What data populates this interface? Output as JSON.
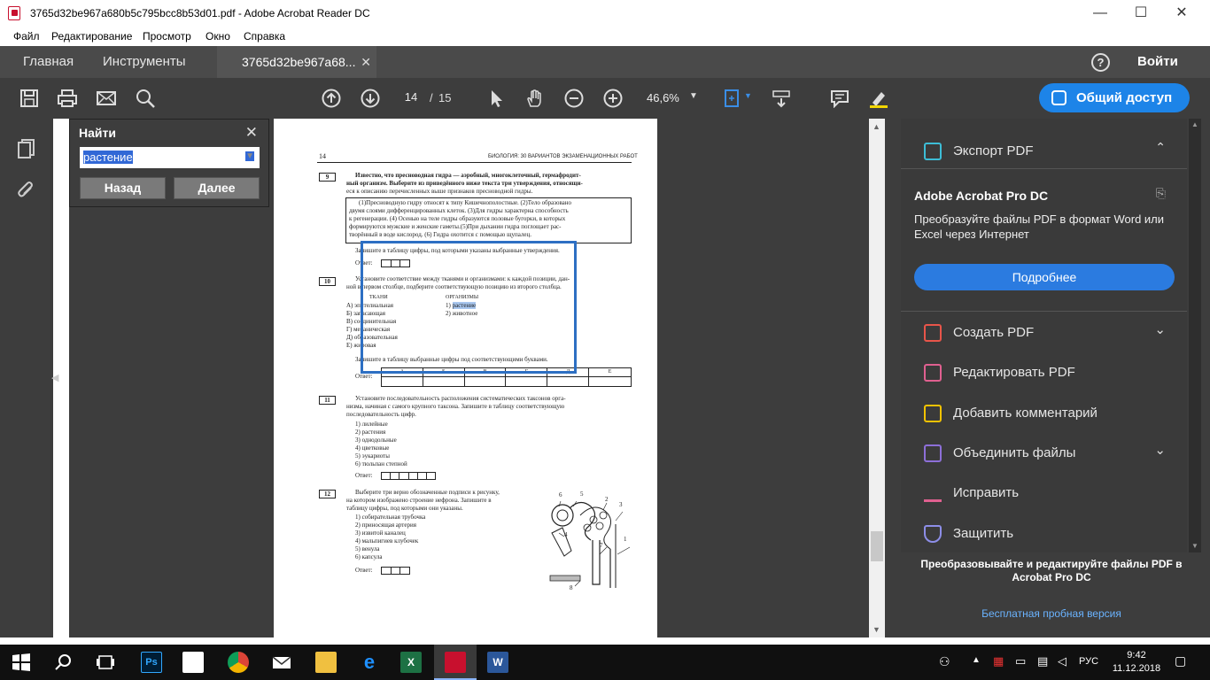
{
  "window": {
    "title": "3765d32be967a680b5c795bcc8b53d01.pdf - Adobe Acrobat Reader DC",
    "minimize": "—",
    "maximize": "☐",
    "close": "✕"
  },
  "menu": {
    "items": [
      "Файл",
      "Редактирование",
      "Просмотр",
      "Окно",
      "Справка"
    ]
  },
  "tabs": {
    "home": "Главная",
    "tools": "Инструменты",
    "doc": "3765d32be967a68...",
    "doc_close": "✕",
    "help": "?",
    "login": "Войти"
  },
  "toolbar": {
    "page_current": "14",
    "page_sep": "/",
    "page_total": "15",
    "zoom": "46,6%",
    "share": "Общий доступ"
  },
  "find": {
    "title": "Найти",
    "close": "✕",
    "query": "растение",
    "back": "Назад",
    "next": "Далее"
  },
  "pdf": {
    "header_page": "14",
    "header_right": "БИОЛОГИЯ: 30 ВАРИАНТОВ ЭКЗАМЕНАЦИОННЫХ РАБОТ",
    "q9": {
      "num": "9",
      "lines": [
        "Известно, что пресноводная гидра — аэробный, многоклеточный, гермафродит-",
        "ный организм. Выберите из приведённого ниже текста три утверждения, относящи-",
        "еся к описанию перечисленных выше признаков пресноводной гидры."
      ],
      "box": [
        "(1)Пресноводную гидру относят к типу Кишечнополостные. (2)Тело образовано",
        "двумя слоями дифференцированных клеток. (3)Для гидры характерна способность",
        "к регенерации. (4) Осенью на теле гидры образуются половые бугорки, в которых",
        "формируются мужские и женские гаметы.(5)При дыхании гидра поглощает рас-",
        "творённый в воде кислород. (6) Гидра охотится с помощью щупалец."
      ],
      "instr": "Запишите в таблицу цифры, под которыми указаны выбранные утверждения.",
      "answer": "Ответ:"
    },
    "q10": {
      "num": "10",
      "lines": [
        "Установите соответствие между тканями и организмами: к каждой позиции, дан-",
        "ной в первом столбце, подберите соответствующую позицию из второго столбца."
      ],
      "col1": "ТКАНИ",
      "col2": "ОРГАНИЗМЫ",
      "tissues": [
        "А) эпителиальная",
        "Б) запасающая",
        "В) соединительная",
        "Г) механическая",
        "Д) образовательная",
        "Е) жировая"
      ],
      "organisms_prefix": [
        "1)",
        "2) животное"
      ],
      "organism_hit": "растение",
      "instr": "Запишите в таблицу выбранные цифры под соответствующими буквами.",
      "answer": "Ответ:",
      "letters": [
        "А",
        "Б",
        "В",
        "Г",
        "Д",
        "Е"
      ]
    },
    "q11": {
      "num": "11",
      "lines": [
        "Установите последовательность расположения систематических таксонов орга-",
        "низма, начиная с самого крупного таксона. Запишите в таблицу соответствующую",
        "последовательность цифр."
      ],
      "items": [
        "1) лилейные",
        "2) растения",
        "3) однодольные",
        "4) цветковые",
        "5) эукариоты",
        "6) тюльпан степной"
      ],
      "answer": "Ответ:"
    },
    "q12": {
      "num": "12",
      "lines": [
        "Выберите три верно обозначенные подписи к рисунку,",
        "на котором изображено строение нефрона. Запишите в",
        "таблицу цифры, под которыми они указаны."
      ],
      "items": [
        "1) собирательная трубочка",
        "2) приносящая артерия",
        "3) извитой каналец",
        "4) мальпигиев клубочек",
        "5) венула",
        "6) капсула"
      ],
      "answer": "Ответ:",
      "fig_labels": [
        "6",
        "5",
        "2",
        "3",
        "4",
        "7",
        "1",
        "8"
      ]
    }
  },
  "right_panel": {
    "export": "Экспорт PDF",
    "promo_title": "Adobe Acrobat Pro DC",
    "promo_desc": "Преобразуйте файлы PDF в формат Word или Excel через Интернет",
    "promo_btn": "Подробнее",
    "items": [
      "Создать PDF",
      "Редактировать PDF",
      "Добавить комментарий",
      "Объединить файлы",
      "Исправить",
      "Защитить"
    ],
    "footer": "Преобразовывайте и редактируйте файлы PDF в Acrobat Pro DC",
    "trial": "Бесплатная пробная версия"
  },
  "taskbar": {
    "lang": "РУС",
    "time": "9:42",
    "date": "11.12.2018"
  }
}
